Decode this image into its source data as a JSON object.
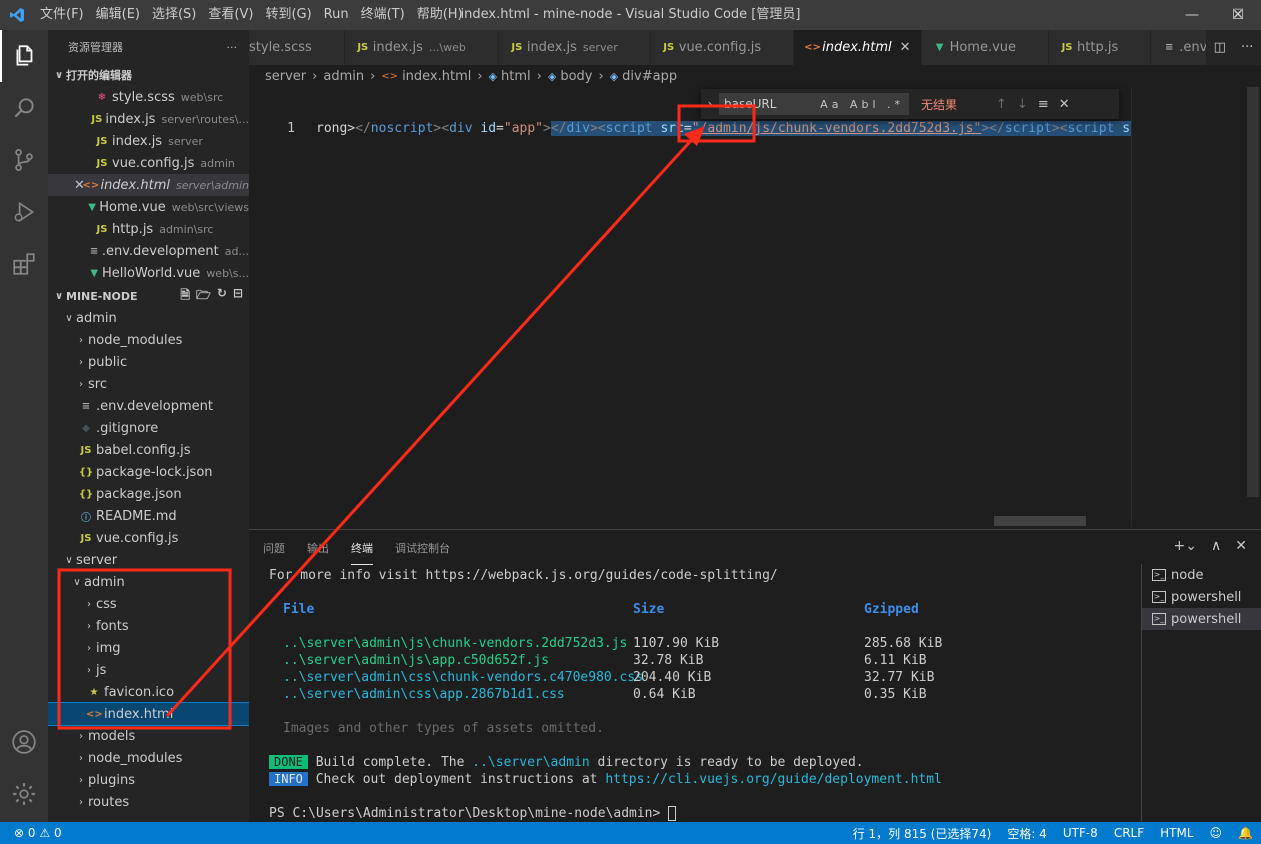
{
  "titlebar": {
    "menu": [
      "文件(F)",
      "编辑(E)",
      "选择(S)",
      "查看(V)",
      "转到(G)",
      "Run",
      "终端(T)",
      "帮助(H)"
    ],
    "title": "index.html - mine-node - Visual Studio Code [管理员]"
  },
  "sidebar": {
    "title": "资源管理器",
    "open_editors_title": "打开的编辑器",
    "open_editors": [
      {
        "icon": "scss",
        "name": "style.scss",
        "desc": "web\\src"
      },
      {
        "icon": "js",
        "name": "index.js",
        "desc": "server\\routes\\..."
      },
      {
        "icon": "js",
        "name": "index.js",
        "desc": "server"
      },
      {
        "icon": "js",
        "name": "vue.config.js",
        "desc": "admin"
      },
      {
        "icon": "html",
        "name": "index.html",
        "desc": "server\\admin"
      },
      {
        "icon": "vue",
        "name": "Home.vue",
        "desc": "web\\src\\views"
      },
      {
        "icon": "js",
        "name": "http.js",
        "desc": "admin\\src"
      },
      {
        "icon": "env",
        "name": ".env.development",
        "desc": "ad..."
      },
      {
        "icon": "vue",
        "name": "HelloWorld.vue",
        "desc": "web\\s..."
      }
    ],
    "project_title": "MINE-NODE",
    "tree": {
      "admin": "admin",
      "admin_children": [
        {
          "type": "folder",
          "name": "node_modules"
        },
        {
          "type": "folder",
          "name": "public"
        },
        {
          "type": "folder",
          "name": "src"
        },
        {
          "type": "file",
          "icon": "env",
          "name": ".env.development"
        },
        {
          "type": "file",
          "icon": "git",
          "name": ".gitignore"
        },
        {
          "type": "file",
          "icon": "js",
          "name": "babel.config.js"
        },
        {
          "type": "file",
          "icon": "json",
          "name": "package-lock.json"
        },
        {
          "type": "file",
          "icon": "json",
          "name": "package.json"
        },
        {
          "type": "file",
          "icon": "info",
          "name": "README.md"
        },
        {
          "type": "file",
          "icon": "js",
          "name": "vue.config.js"
        }
      ],
      "server": "server",
      "server_admin": "admin",
      "server_admin_children": [
        {
          "type": "folder",
          "name": "css"
        },
        {
          "type": "folder",
          "name": "fonts"
        },
        {
          "type": "folder",
          "name": "img"
        },
        {
          "type": "folder",
          "name": "js"
        },
        {
          "type": "file",
          "icon": "star",
          "name": "favicon.ico"
        },
        {
          "type": "file",
          "icon": "html",
          "name": "index.html"
        }
      ],
      "server_rest": [
        {
          "type": "folder",
          "name": "models"
        },
        {
          "type": "folder",
          "name": "node_modules"
        },
        {
          "type": "folder",
          "name": "plugins"
        },
        {
          "type": "folder",
          "name": "routes"
        }
      ]
    }
  },
  "tabs": [
    {
      "icon": "scss",
      "name": "style.scss",
      "desc": ""
    },
    {
      "icon": "js",
      "name": "index.js",
      "desc": "...\\web"
    },
    {
      "icon": "js",
      "name": "index.js",
      "desc": "server"
    },
    {
      "icon": "js",
      "name": "vue.config.js",
      "desc": ""
    },
    {
      "icon": "html",
      "name": "index.html",
      "desc": "",
      "active": true
    },
    {
      "icon": "vue",
      "name": "Home.vue",
      "desc": ""
    },
    {
      "icon": "js",
      "name": "http.js",
      "desc": ""
    },
    {
      "icon": "env",
      "name": ".env.devel",
      "desc": ""
    }
  ],
  "breadcrumb": [
    "server",
    "admin",
    "index.html",
    "html",
    "body",
    "div#app"
  ],
  "editor": {
    "line_number": "1",
    "tokens": {
      "t1": "rong>",
      "t2": "</",
      "t3": "noscript",
      "t4": "><",
      "t5": "div",
      "t6": "id",
      "t7": "=",
      "t8": "\"app\"",
      "t9": ">",
      "t10": "</",
      "t11": "div",
      "t12": "><",
      "t13": "script",
      "t14": "src",
      "t15": "=",
      "t16": "\"/admin/js/chunk-vendors.2dd752d3.js\"",
      "t17": "></",
      "t18": "script",
      "t19": "><",
      "t20": "script",
      "t21": "src"
    }
  },
  "find_widget": {
    "value": "baseURL",
    "options": "Aa Abl .*",
    "result": "无结果"
  },
  "panel": {
    "tabs": [
      "问题",
      "输出",
      "终端",
      "调试控制台"
    ],
    "active_tab": "终端",
    "terminal_lines": {
      "l1": "For more info visit https://webpack.js.org/guides/code-splitting/",
      "h_file": "File",
      "h_size": "Size",
      "h_gzip": "Gzipped",
      "rows": [
        {
          "file": "..\\server\\admin\\js\\chunk-vendors.2dd752d3.js",
          "size": "1107.90 KiB",
          "gzip": "285.68 KiB",
          "color": "green"
        },
        {
          "file": "..\\server\\admin\\js\\app.c50d652f.js",
          "size": "32.78 KiB",
          "gzip": "6.11 KiB",
          "color": "green"
        },
        {
          "file": "..\\server\\admin\\css\\chunk-vendors.c470e980.css",
          "size": "204.40 KiB",
          "gzip": "32.77 KiB",
          "color": "cyan"
        },
        {
          "file": "..\\server\\admin\\css\\app.2867b1d1.css",
          "size": "0.64 KiB",
          "gzip": "0.35 KiB",
          "color": "cyan"
        }
      ],
      "omitted": "Images and other types of assets omitted.",
      "done_badge": "DONE",
      "done_a": "Build complete. The ",
      "done_b": "..\\server\\admin",
      "done_c": " directory is ready to be deployed.",
      "info_badge": "INFO",
      "info_a": "Check out deployment instructions at ",
      "info_b": "https://cli.vuejs.org/guide/deployment.html",
      "prompt": "PS C:\\Users\\Administrator\\Desktop\\mine-node\\admin> "
    },
    "terminals": [
      "node",
      "powershell",
      "powershell"
    ]
  },
  "statusbar": {
    "errors": "0",
    "warnings": "0",
    "position": "行 1，列 815 (已选择74)",
    "spaces": "空格: 4",
    "encoding": "UTF-8",
    "eol": "CRLF",
    "language": "HTML"
  },
  "colors": {
    "accent": "#007acc",
    "annotation": "#ff2a1a"
  }
}
